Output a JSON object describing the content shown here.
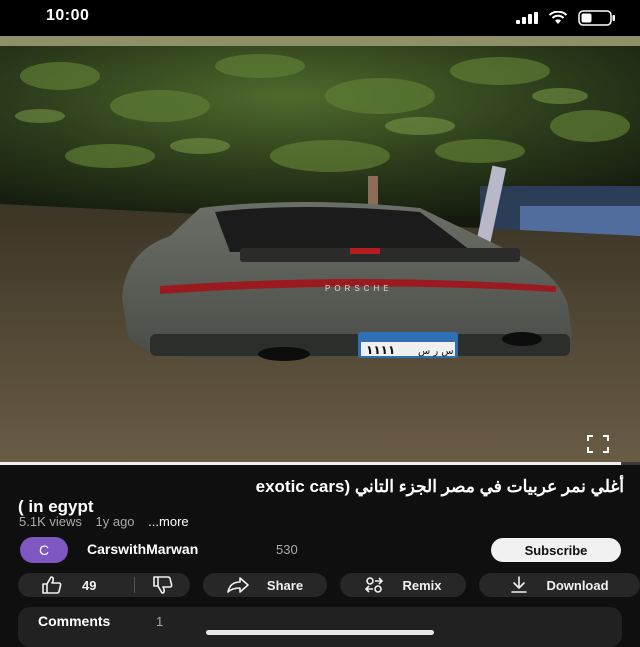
{
  "status_bar": {
    "time": "10:00"
  },
  "video": {
    "progress": 0.97
  },
  "video_info": {
    "title_line1": "أغلي نمر عربيات في مصر الجزء التاني (exotic cars",
    "title_line2": "in egypt )",
    "views": "5.1K views",
    "age": "1y ago",
    "more_label": "...more"
  },
  "channel": {
    "avatar_letter": "C",
    "name": "CarswithMarwan",
    "subscribers": "530",
    "subscribe_label": "Subscribe"
  },
  "actions": {
    "like_count": "49",
    "share_label": "Share",
    "remix_label": "Remix",
    "download_label": "Download"
  },
  "comments": {
    "label": "Comments",
    "count": "1"
  },
  "colors": {
    "background": "#0f0f0f",
    "pill": "#272727",
    "avatar": "#7e57c2"
  }
}
